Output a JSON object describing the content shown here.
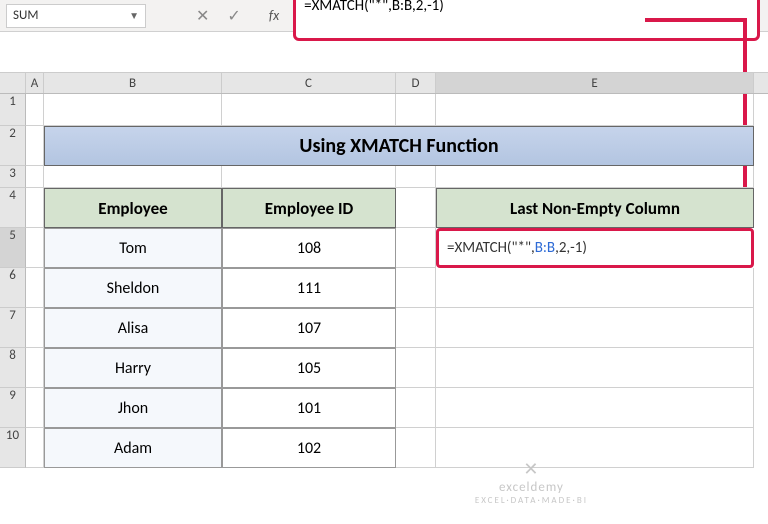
{
  "namebox": "SUM",
  "formula_bar": "=XMATCH(\"*\",B:B,2,-1)",
  "columns": [
    "A",
    "B",
    "C",
    "D",
    "E"
  ],
  "title": "Using XMATCH Function",
  "headers": {
    "B": "Employee",
    "C": "Employee ID",
    "E": "Last Non-Empty Column"
  },
  "rows": [
    {
      "emp": "Tom",
      "id": "108"
    },
    {
      "emp": "Sheldon",
      "id": "111"
    },
    {
      "emp": "Alisa",
      "id": "107"
    },
    {
      "emp": "Harry",
      "id": "105"
    },
    {
      "emp": "Jhon",
      "id": "101"
    },
    {
      "emp": "Adam",
      "id": "102"
    }
  ],
  "e5_prefix": "=XMATCH(\"*\",",
  "e5_ref": "B:B",
  "e5_suffix": ",2,-1)",
  "watermark": {
    "icon": "✕",
    "name": "exceldemy",
    "sub": "EXCEL·DATA·MADE·BI"
  }
}
